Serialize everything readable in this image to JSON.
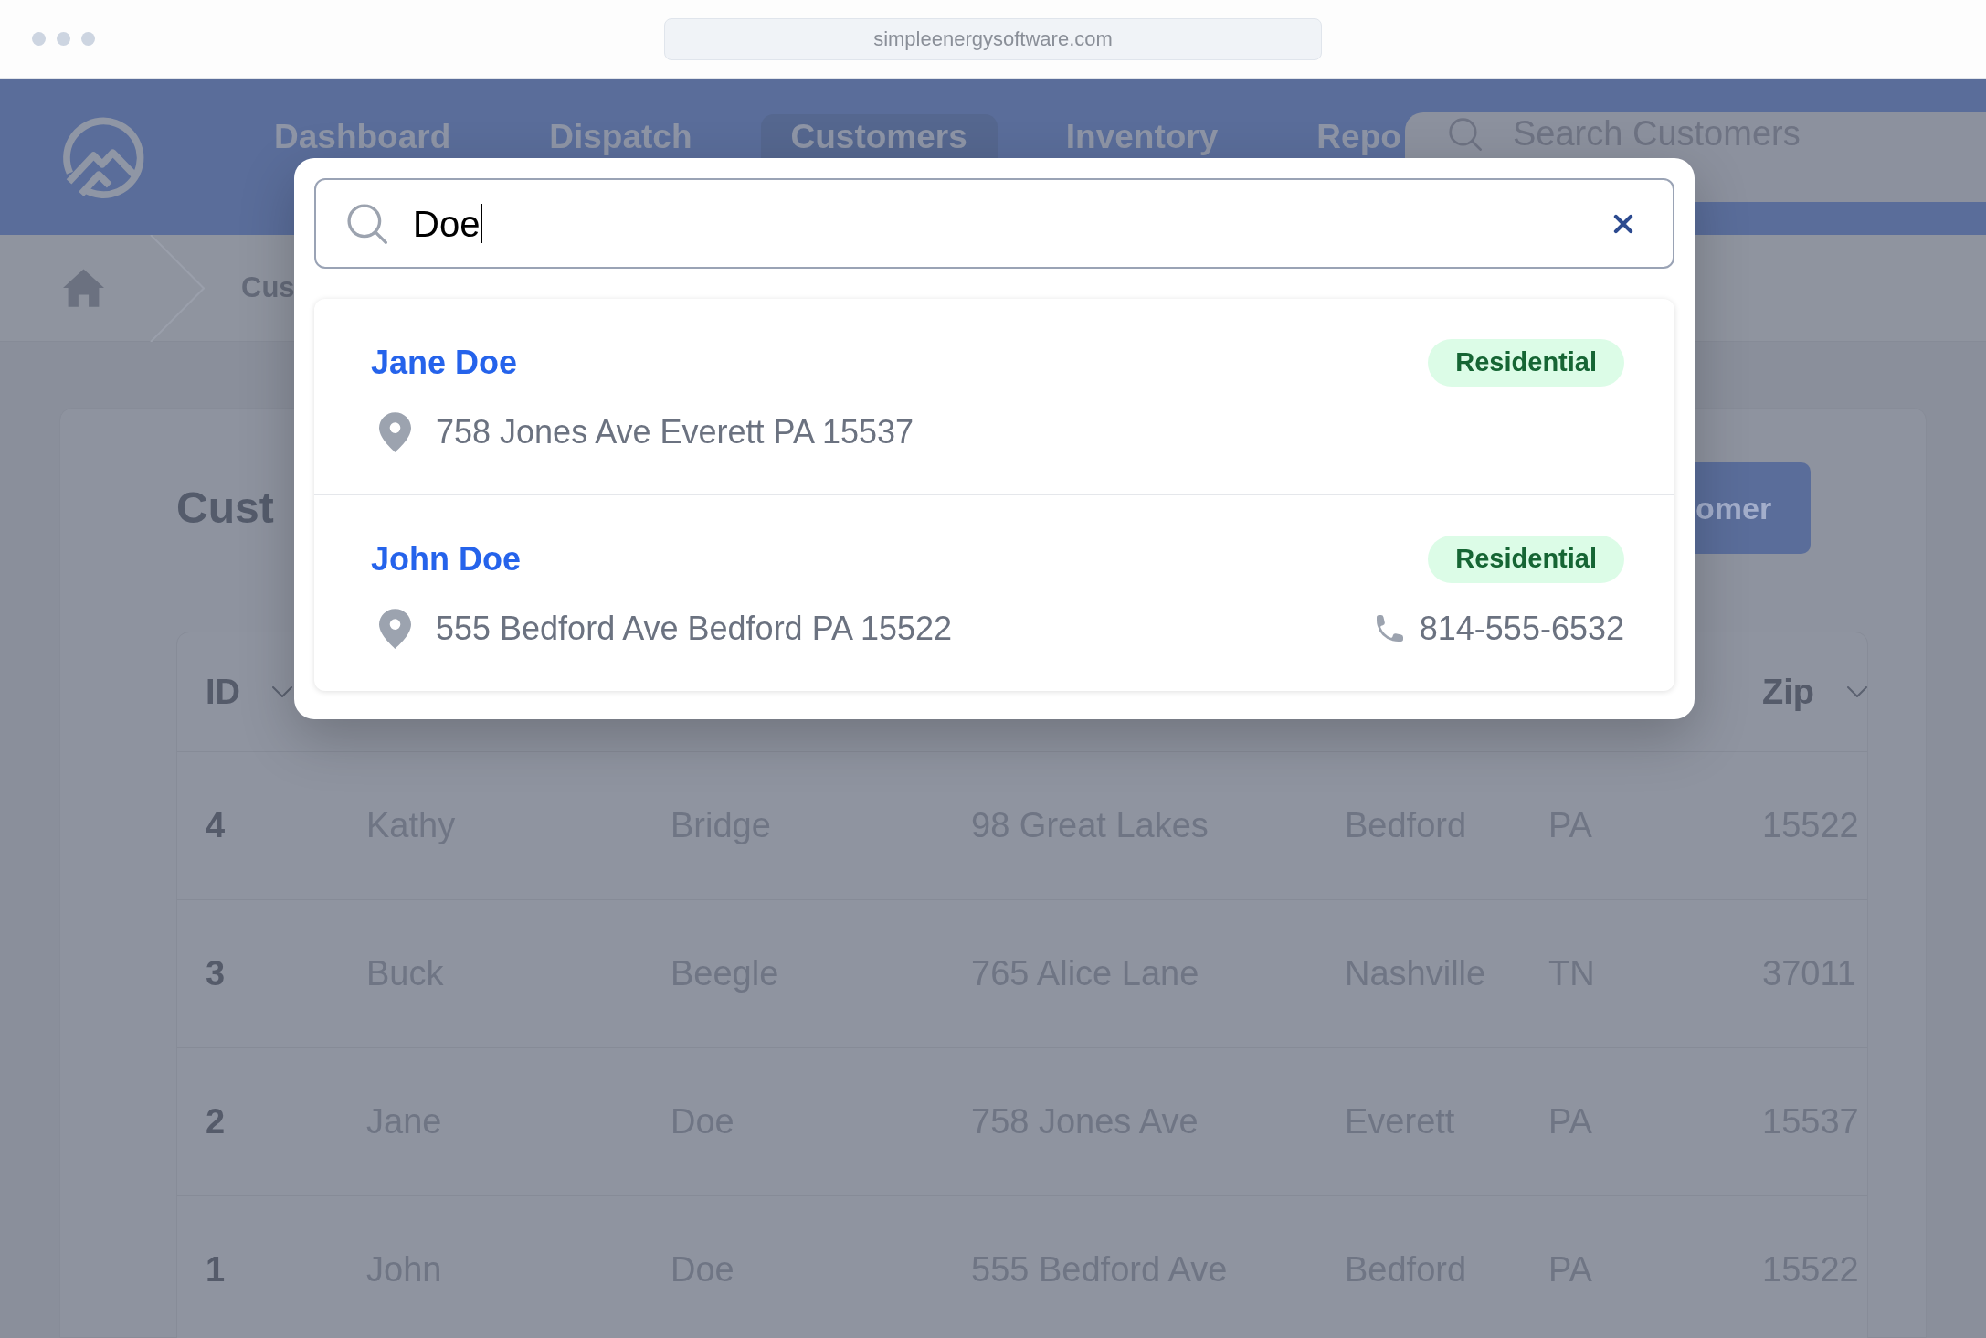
{
  "browser": {
    "url": "simpleenergysoftware.com"
  },
  "nav": {
    "items": [
      {
        "label": "Dashboard",
        "selected": false
      },
      {
        "label": "Dispatch",
        "selected": false
      },
      {
        "label": "Customers",
        "selected": true
      },
      {
        "label": "Inventory",
        "selected": false
      },
      {
        "label": "Repo",
        "selected": false
      }
    ],
    "search": {
      "placeholder": "Search Customers"
    }
  },
  "breadcrumb": {
    "current": "Cus"
  },
  "page": {
    "title": "Cust",
    "button": "omer"
  },
  "table": {
    "columns": [
      {
        "label": "ID",
        "sortable": true
      },
      {},
      {},
      {},
      {},
      {},
      {
        "label": "Zip",
        "sortable": true
      }
    ],
    "rows": [
      {
        "cells": [
          "4",
          "Kathy",
          "Bridge",
          "98 Great Lakes",
          "Bedford",
          "PA",
          "15522"
        ]
      },
      {
        "cells": [
          "3",
          "Buck",
          "Beegle",
          "765 Alice Lane",
          "Nashville",
          "TN",
          "37011"
        ]
      },
      {
        "cells": [
          "2",
          "Jane",
          "Doe",
          "758 Jones Ave",
          "Everett",
          "PA",
          "15537"
        ]
      },
      {
        "cells": [
          "1",
          "John",
          "Doe",
          "555 Bedford Ave",
          "Bedford",
          "PA",
          "15522"
        ]
      }
    ]
  },
  "search_dialog": {
    "query": "Doe",
    "results": [
      {
        "name": "Jane Doe",
        "tag": "Residential",
        "address": "758 Jones Ave Everett PA 15537"
      },
      {
        "name": "John Doe",
        "tag": "Residential",
        "address": "555 Bedford Ave Bedford PA 15522",
        "phone": "814-555-6532"
      }
    ]
  }
}
